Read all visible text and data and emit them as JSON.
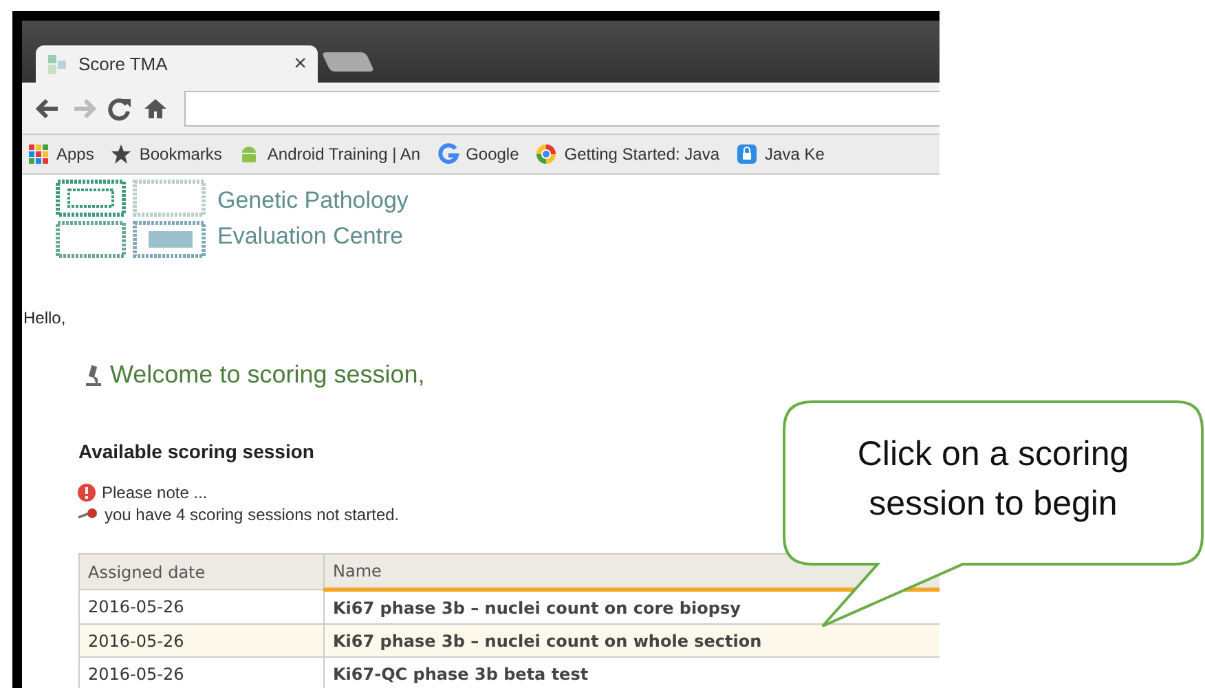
{
  "browser": {
    "tabs": [
      {
        "title": "Score TMA",
        "close": "×",
        "selected": true
      }
    ],
    "nav_buttons": [
      {
        "kind": "back",
        "disabled": false
      },
      {
        "kind": "forward",
        "disabled": true
      },
      {
        "kind": "reload",
        "disabled": false
      },
      {
        "kind": "home",
        "disabled": false
      }
    ],
    "bookmarks": [
      {
        "kind": "apps",
        "label": "Apps"
      },
      {
        "kind": "star",
        "label": "Bookmarks"
      },
      {
        "kind": "android",
        "label": "Android Training | An"
      },
      {
        "kind": "google",
        "label": "Google"
      },
      {
        "kind": "chrome",
        "label": "Getting Started: Java"
      },
      {
        "kind": "lock",
        "label": "Java Ke"
      }
    ]
  },
  "page": {
    "logo": [
      "Genetic Pathology",
      "Evaluation Centre"
    ],
    "greeting": "Hello,",
    "welcome": "Welcome to scoring session,",
    "section_title": "Available scoring session",
    "notice": {
      "title": "Please note ...",
      "message": "you have 4 scoring sessions not started."
    },
    "table": {
      "columns": [
        "Assigned date",
        "Name"
      ],
      "rows": [
        {
          "cells": [
            "2016-05-26",
            "Ki67 phase 3b – nuclei count on core biopsy"
          ],
          "selected": false
        },
        {
          "cells": [
            "2016-05-26",
            "Ki67 phase 3b – nuclei count on whole section"
          ],
          "selected": true
        },
        {
          "cells": [
            "2016-05-26",
            "Ki67-QC phase 3b beta test"
          ],
          "selected": false
        }
      ]
    }
  },
  "callout": {
    "text": "Click on a scoring session to begin"
  }
}
